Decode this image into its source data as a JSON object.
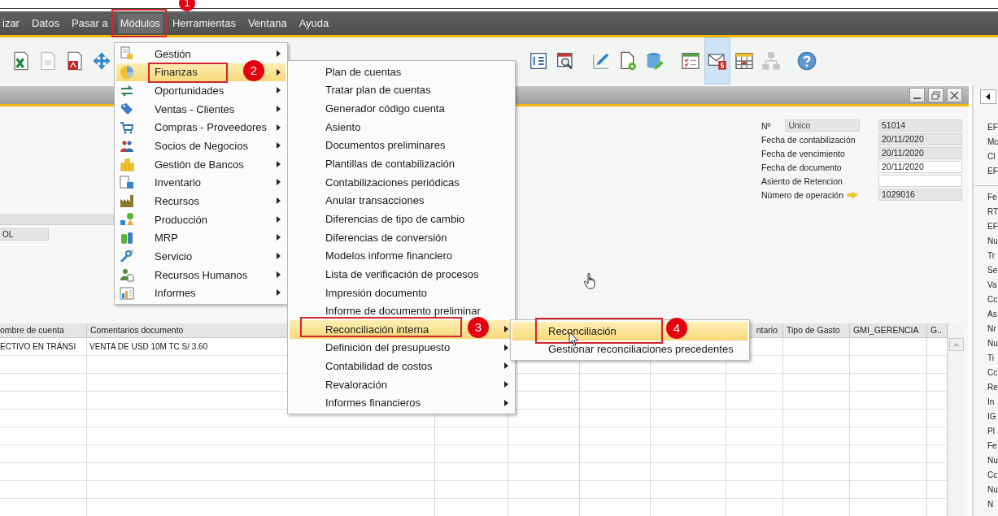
{
  "menu_bar": [
    {
      "label": "izar",
      "selected": false
    },
    {
      "label": "Datos",
      "selected": false
    },
    {
      "label": "Pasar a",
      "selected": false
    },
    {
      "label": "Módulos",
      "selected": true
    },
    {
      "label": "Herramientas",
      "selected": false
    },
    {
      "label": "Ventana",
      "selected": false
    },
    {
      "label": "Ayuda",
      "selected": false
    }
  ],
  "toolbar": [
    {
      "items": [
        {
          "kind": "excel",
          "selected": false,
          "disabled": false
        },
        {
          "kind": "word",
          "selected": false,
          "disabled": true
        },
        {
          "kind": "pdf",
          "selected": false,
          "disabled": false
        },
        {
          "kind": "move",
          "selected": false,
          "disabled": false
        }
      ]
    },
    {
      "items": [
        {
          "kind": "report",
          "selected": false,
          "disabled": false
        },
        {
          "kind": "zoom",
          "selected": false,
          "disabled": false
        }
      ]
    },
    {
      "items": [
        {
          "kind": "pencil",
          "selected": false,
          "disabled": false
        },
        {
          "kind": "gear",
          "selected": false,
          "disabled": false
        },
        {
          "kind": "wrench",
          "selected": false,
          "disabled": false
        }
      ]
    },
    {
      "items": [
        {
          "kind": "checklist",
          "selected": false,
          "disabled": false
        },
        {
          "kind": "mail",
          "selected": true,
          "disabled": false
        },
        {
          "kind": "calendar",
          "selected": false,
          "disabled": false
        },
        {
          "kind": "tree",
          "selected": false,
          "disabled": true
        }
      ]
    },
    {
      "items": [
        {
          "kind": "help",
          "selected": false,
          "disabled": false
        }
      ]
    }
  ],
  "document": {
    "fields": [
      {
        "label": "Nº",
        "series": "Unico",
        "value": "51014",
        "disabled": true,
        "kind": "plain"
      },
      {
        "label": "Fecha de contabilización",
        "value": "20/11/2020",
        "disabled": true,
        "kind": "plain"
      },
      {
        "label": "Fecha de vencimiento",
        "value": "20/11/2020",
        "disabled": true,
        "kind": "plain"
      },
      {
        "label": "Fecha de documento",
        "value": "20/11/2020",
        "disabled": false,
        "kind": "plain"
      },
      {
        "label": "Asiento de Retencion",
        "disabled": false,
        "kind": "plain"
      },
      {
        "label": "Número de operación",
        "value": "1029016",
        "disabled": true,
        "kind": "link"
      }
    ],
    "side_field": {
      "value": "OL"
    },
    "table": {
      "columns": [
        "ombre de cuenta",
        "Comentarios documento",
        null,
        null,
        null,
        null,
        "ntario",
        "Tipo de Gasto",
        "GMI_GERENCIA",
        "G.."
      ],
      "rows": [
        [
          "ECTIVO EN TRÁNSI",
          "VENTA DE USD 10M TC S/ 3.60"
        ]
      ]
    }
  },
  "side_panel": {
    "upper_labels": [
      "EF",
      "Mc",
      "Cl",
      "EF"
    ],
    "lower_labels": [
      "Fe",
      "RT",
      "EF",
      "Nu",
      "Tr",
      "Se",
      "Va",
      "Cc",
      "As",
      "Nr",
      "Nu",
      "Ti",
      "Cc",
      "Re",
      "In",
      "IG",
      "Pl",
      "Fe",
      "Nu",
      "Cc",
      "Nu",
      "N"
    ]
  },
  "menus": [
    {
      "items": [
        {
          "label": "Gestión",
          "kind": "document",
          "selected": false,
          "has_submenu": true
        },
        {
          "label": "Finanzas",
          "kind": "pie",
          "selected": true,
          "has_submenu": true
        },
        {
          "label": "Oportunidades",
          "kind": "arrows",
          "selected": false,
          "has_submenu": true
        },
        {
          "label": "Ventas - Clientes",
          "kind": "tag",
          "selected": false,
          "has_submenu": true
        },
        {
          "label": "Compras - Proveedores",
          "kind": "cart",
          "selected": false,
          "has_submenu": true
        },
        {
          "label": "Socios de Negocios",
          "kind": "people",
          "selected": false,
          "has_submenu": true
        },
        {
          "label": "Gestión de Bancos",
          "kind": "coins",
          "selected": false,
          "has_submenu": true
        },
        {
          "label": "Inventario",
          "kind": "grid",
          "selected": false,
          "has_submenu": true
        },
        {
          "label": "Recursos",
          "kind": "factory",
          "selected": false,
          "has_submenu": true
        },
        {
          "label": "Producción",
          "kind": "shapes",
          "selected": false,
          "has_submenu": true
        },
        {
          "label": "MRP",
          "kind": "puzzle",
          "selected": false,
          "has_submenu": true
        },
        {
          "label": "Servicio",
          "kind": "wrench",
          "selected": false,
          "has_submenu": true
        },
        {
          "label": "Recursos Humanos",
          "kind": "person",
          "selected": false,
          "has_submenu": true
        },
        {
          "label": "Informes",
          "kind": "chart",
          "selected": false,
          "has_submenu": true
        }
      ]
    },
    {
      "items": [
        {
          "label": "Plan de cuentas",
          "selected": false,
          "has_submenu": false
        },
        {
          "label": "Tratar plan de cuentas",
          "selected": false,
          "has_submenu": false
        },
        {
          "label": "Generador código cuenta",
          "selected": false,
          "has_submenu": false
        },
        {
          "label": "Asiento",
          "selected": false,
          "has_submenu": false
        },
        {
          "label": "Documentos preliminares",
          "selected": false,
          "has_submenu": false
        },
        {
          "label": "Plantillas de contabilización",
          "selected": false,
          "has_submenu": false
        },
        {
          "label": "Contabilizaciones periódicas",
          "selected": false,
          "has_submenu": false
        },
        {
          "label": "Anular transacciones",
          "selected": false,
          "has_submenu": false
        },
        {
          "label": "Diferencias de tipo de cambio",
          "selected": false,
          "has_submenu": false
        },
        {
          "label": "Diferencias de conversión",
          "selected": false,
          "has_submenu": false
        },
        {
          "label": "Modelos informe financiero",
          "selected": false,
          "has_submenu": false
        },
        {
          "label": "Lista de verificación de procesos",
          "selected": false,
          "has_submenu": false
        },
        {
          "label": "Impresión documento",
          "selected": false,
          "has_submenu": false
        },
        {
          "label": "Informe de documento preliminar",
          "selected": false,
          "has_submenu": false
        },
        {
          "label": "Reconciliación interna",
          "selected": true,
          "has_submenu": true
        },
        {
          "label": "Definición del presupuesto",
          "selected": false,
          "has_submenu": true
        },
        {
          "label": "Contabilidad de costos",
          "selected": false,
          "has_submenu": true
        },
        {
          "label": "Revaloración",
          "selected": false,
          "has_submenu": true
        },
        {
          "label": "Informes financieros",
          "selected": false,
          "has_submenu": true
        }
      ]
    },
    {
      "items": [
        {
          "label": "Reconciliación",
          "selected": true,
          "has_submenu": false
        },
        {
          "label": "Gestionar reconciliaciones precedentes",
          "selected": false,
          "has_submenu": false
        }
      ]
    }
  ],
  "callouts": [
    "1",
    "2",
    "3",
    "4"
  ]
}
